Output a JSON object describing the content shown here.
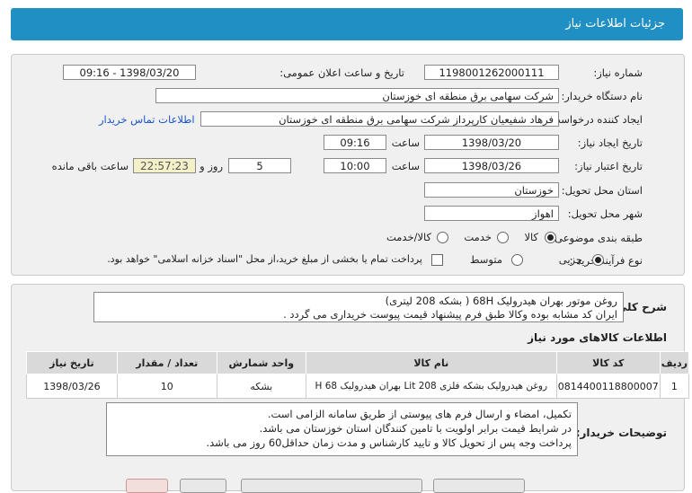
{
  "header": {
    "title": "جزئیات اطلاعات نیاز"
  },
  "form": {
    "need_number_label": "شماره نیاز:",
    "need_number": "1198001262000111",
    "announce_label": "تاریخ و ساعت اعلان عمومی:",
    "announce_value": "1398/03/20 - 09:16",
    "buyer_org_label": "نام دستگاه خریدار:",
    "buyer_org": "شرکت سهامی برق منطقه ای خوزستان",
    "requester_label": "ایجاد کننده درخواست:",
    "requester": "فرهاد شفیعیان کارپرداز شرکت سهامی برق منطقه ای خوزستان",
    "contact_link": "اطلاعات تماس خریدار",
    "created_label": "تاریخ ایجاد نیاز:",
    "created_date": "1398/03/20",
    "hour_label": "ساعت",
    "created_time": "09:16",
    "valid_label": "تاریخ اعتبار نیاز:",
    "valid_date": "1398/03/26",
    "valid_time": "10:00",
    "days": "5",
    "days_label": "روز و",
    "remaining": "22:57:23",
    "remaining_label": "ساعت باقی مانده",
    "province_label": "استان محل تحویل:",
    "province": "خوزستان",
    "city_label": "شهر محل تحویل:",
    "city": "اهواز",
    "category_label": "طبقه بندی موضوعی:",
    "category_options": [
      "کالا",
      "خدمت",
      "کالا/خدمت"
    ],
    "category_selected": "کالا",
    "process_label": "نوع فرآیند خرید :",
    "process_options": [
      "جزیی",
      "متوسط"
    ],
    "process_selected": "جزیی",
    "payment_note": "پرداخت تمام یا بخشی از مبلغ خرید،از محل \"اسناد خزانه اسلامی\" خواهد بود."
  },
  "details": {
    "summary_label": "شرح کلی نیاز:",
    "summary_lines": [
      "روغن موتور بهران هیدرولیک 68H ( بشکه 208 لیتری)",
      "ایران کد مشابه بوده وکالا طبق فرم پیشنهاد قیمت پیوست خریداری می گردد ."
    ],
    "goods_title": "اطلاعات کالاهای مورد نیاز",
    "table_headers": [
      "ردیف",
      "کد کالا",
      "نام کالا",
      "واحد شمارش",
      "تعداد / مقدار",
      "تاریخ نیاز"
    ],
    "table_rows": [
      [
        "1",
        "0814400118800007",
        "روغن هیدرولیک بشکه فلزی 208 Lit بهران هیدرولیک H 68",
        "بشکه",
        "10",
        "1398/03/26"
      ]
    ],
    "buyer_notes_label": "توضیحات خریدار:",
    "buyer_notes": [
      "تکمیل، امضاء و ارسال فرم های پیوستی از طریق سامانه الزامی است.",
      "در شرایط  قیمت برابر اولویت با تامین کنندگان استان خوزستان می باشد.",
      "پرداخت وجه پس از تحویل کالا و تایید کارشناس و مدت زمان حداقل60 روز می باشد."
    ]
  },
  "colors": {
    "header_bg": "#1f8fc4",
    "panel_bg": "#f0f0f0",
    "remaining_bg": "#f4f0c8",
    "link": "#1a55c8"
  }
}
